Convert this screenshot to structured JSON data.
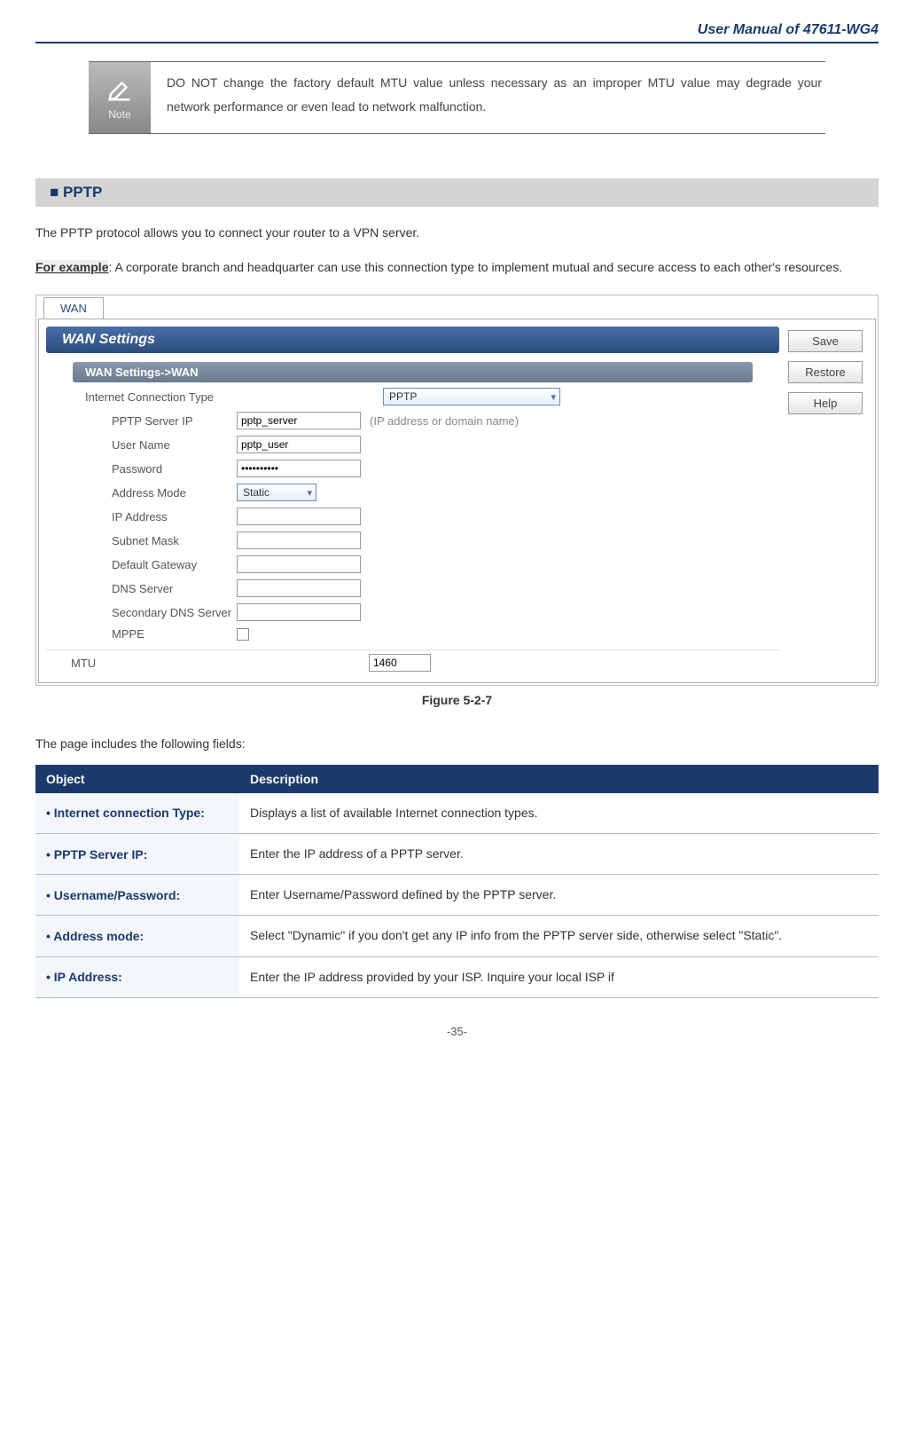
{
  "header": {
    "title": "User Manual of 47611-WG4"
  },
  "note": {
    "icon_label": "Note",
    "text": "DO NOT change the factory default MTU value unless necessary as an improper MTU value may degrade your network performance or even lead to network malfunction."
  },
  "section": {
    "heading": "PPTP",
    "intro": "The PPTP protocol allows you to connect your router to a VPN server.",
    "example_label": "For example",
    "example_text": ": A corporate branch and headquarter can use this connection type to implement mutual and secure access to each other's resources."
  },
  "screenshot": {
    "tab": "WAN",
    "banner": "WAN Settings",
    "sub_banner": "WAN Settings->WAN",
    "rows": {
      "conn_type_label": "Internet Connection Type",
      "conn_type_value": "PPTP",
      "server_label": "PPTP Server IP",
      "server_value": "pptp_server",
      "server_hint": "(IP address or domain name)",
      "user_label": "User Name",
      "user_value": "pptp_user",
      "pass_label": "Password",
      "pass_value": "••••••••••",
      "addr_mode_label": "Address Mode",
      "addr_mode_value": "Static",
      "ip_label": "IP Address",
      "mask_label": "Subnet Mask",
      "gw_label": "Default Gateway",
      "dns_label": "DNS Server",
      "dns2_label": "Secondary DNS Server",
      "mppe_label": "MPPE",
      "mtu_label": "MTU",
      "mtu_value": "1460"
    },
    "side": {
      "save": "Save",
      "restore": "Restore",
      "help": "Help"
    },
    "caption": "Figure 5-2-7"
  },
  "fields": {
    "intro": "The page includes the following fields:",
    "headers": {
      "object": "Object",
      "desc": "Description"
    },
    "rows": [
      {
        "obj": "Internet connection Type:",
        "desc": "Displays a list of available Internet connection types."
      },
      {
        "obj": "PPTP Server IP:",
        "desc": "Enter the IP address of a PPTP server."
      },
      {
        "obj": "Username/Password:",
        "desc": "Enter Username/Password defined by the PPTP server."
      },
      {
        "obj": "Address mode:",
        "desc": "Select \"Dynamic\" if you don't get any IP info from the PPTP server side, otherwise select \"Static\"."
      },
      {
        "obj": "IP Address:",
        "desc": "Enter the IP address provided by your ISP. Inquire your local ISP if"
      }
    ]
  },
  "page_number": "-35-"
}
